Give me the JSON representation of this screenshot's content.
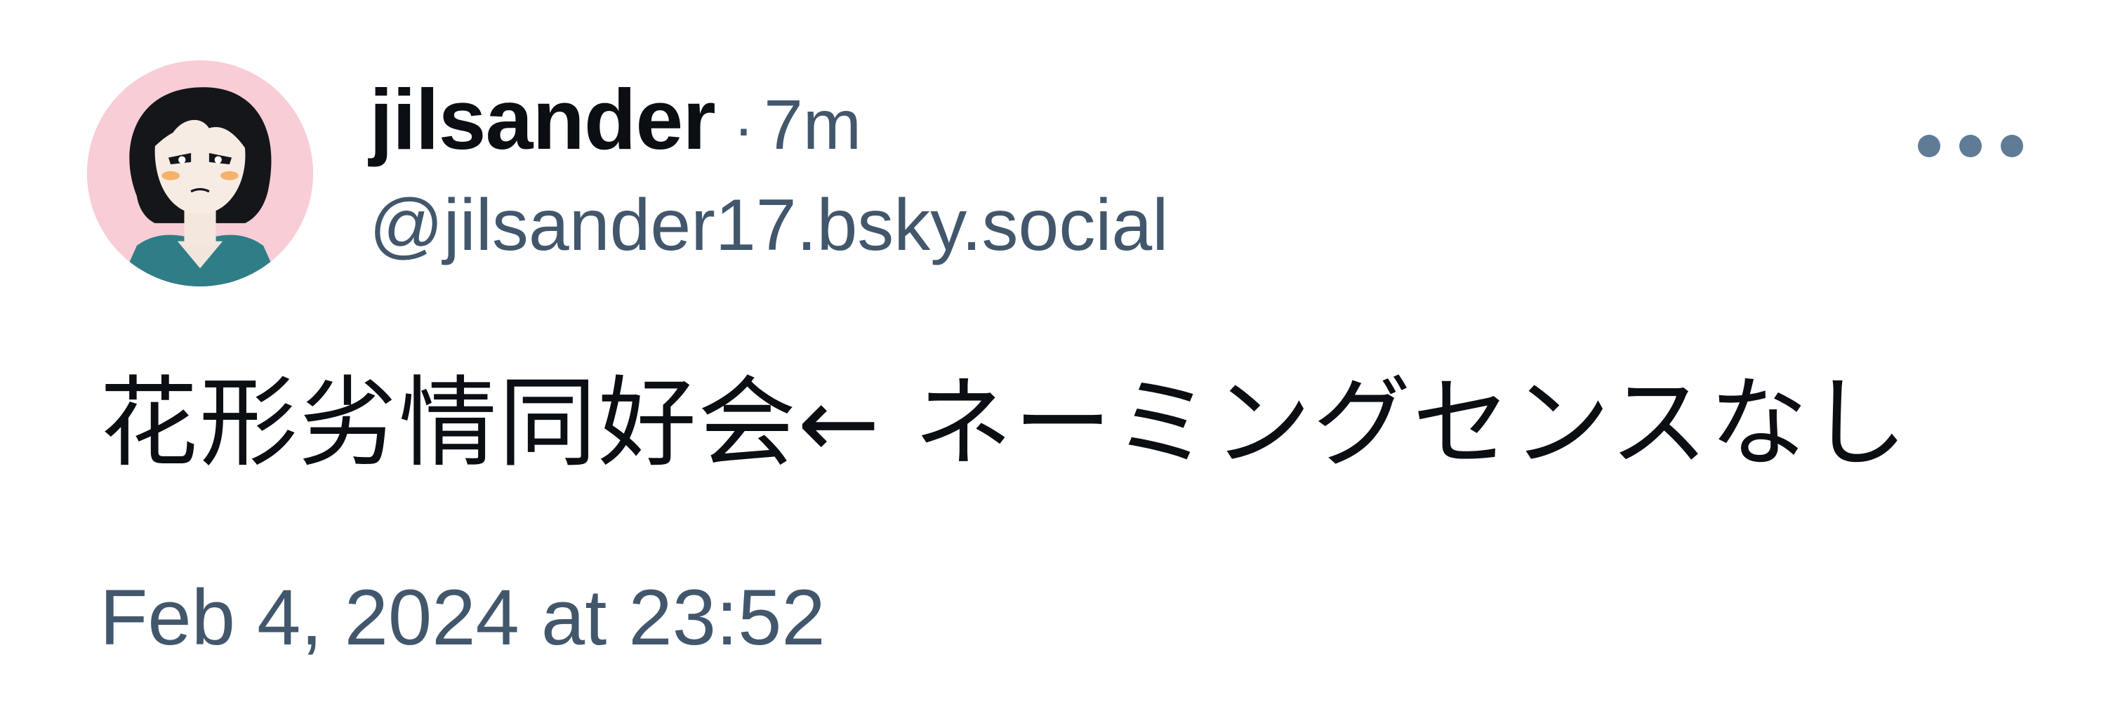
{
  "post": {
    "author": {
      "display_name": "jilsander",
      "handle": "@jilsander17.bsky.social"
    },
    "separator": "·",
    "time_ago": "7m",
    "text": "花形劣情同好会← ネーミングセンスなし",
    "timestamp": "Feb 4, 2024 at 23:52",
    "more_icon": "more-horizontal-icon"
  },
  "colors": {
    "primary_text": "#0b0f14",
    "secondary_text": "#42576c",
    "icon": "#607b96",
    "avatar_bg": "#f8cdd6"
  }
}
